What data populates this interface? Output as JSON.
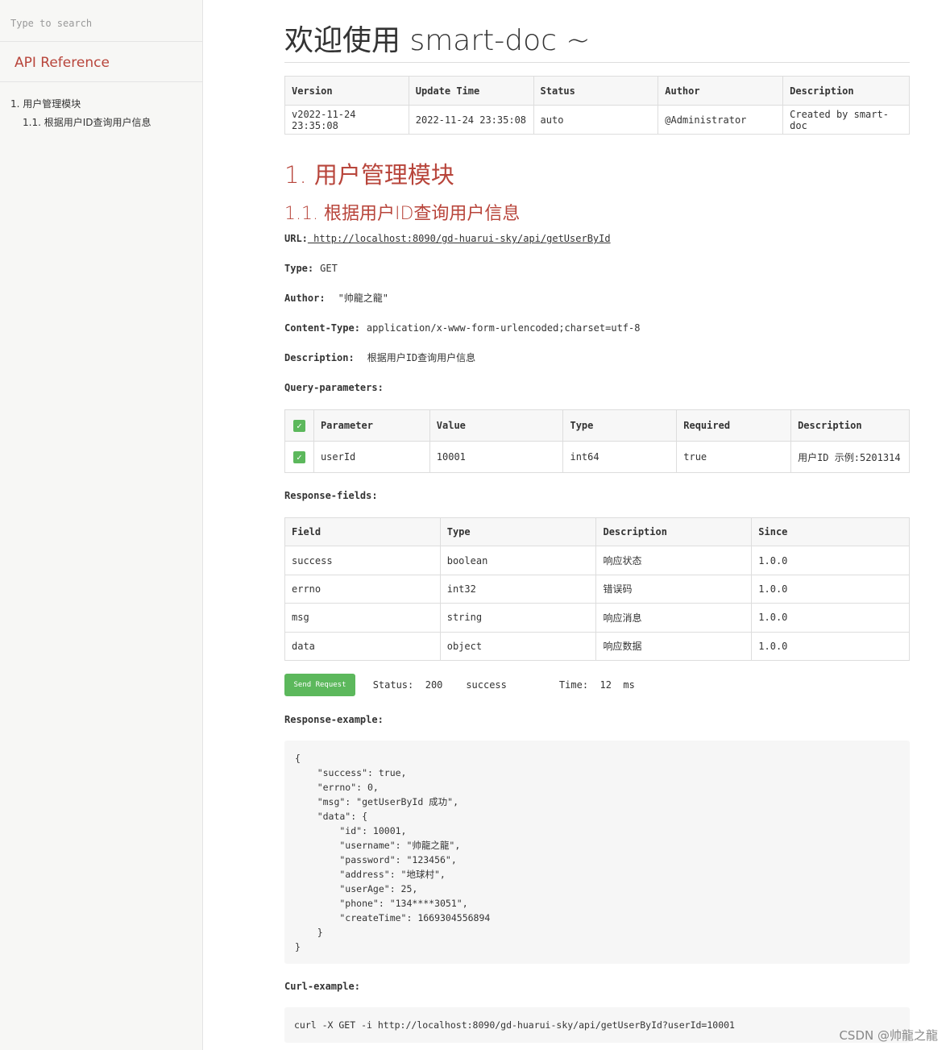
{
  "sidebar": {
    "search_placeholder": "Type to search",
    "title": "API Reference",
    "items": [
      {
        "label": "1. 用户管理模块"
      },
      {
        "label": "1.1. 根据用户ID查询用户信息"
      }
    ]
  },
  "page": {
    "title": "欢迎使用 smart-doc ~"
  },
  "info_table": {
    "headers": [
      "Version",
      "Update Time",
      "Status",
      "Author",
      "Description"
    ],
    "row": [
      "v2022-11-24 23:35:08",
      "2022-11-24 23:35:08",
      "auto",
      "@Administrator",
      "Created by smart-doc"
    ]
  },
  "module": {
    "title": "1. 用户管理模块"
  },
  "api": {
    "title": "1.1. 根据用户ID查询用户信息",
    "url_label": "URL:",
    "url": " http://localhost:8090/gd-huarui-sky/api/getUserById",
    "type_label": "Type:",
    "type": "GET",
    "author_label": "Author:",
    "author": "\"帅龍之龍\"",
    "content_type_label": "Content-Type:",
    "content_type": "application/x-www-form-urlencoded;charset=utf-8",
    "description_label": "Description:",
    "description": "根据用户ID查询用户信息",
    "query_params_label": "Query-parameters:",
    "response_fields_label": "Response-fields:",
    "response_example_label": "Response-example:",
    "curl_example_label": "Curl-example:"
  },
  "param_table": {
    "headers": [
      "Parameter",
      "Value",
      "Type",
      "Required",
      "Description"
    ],
    "rows": [
      [
        "userId",
        "10001",
        "int64",
        "true",
        "用户ID 示例:5201314"
      ]
    ]
  },
  "resp_table": {
    "headers": [
      "Field",
      "Type",
      "Description",
      "Since"
    ],
    "rows": [
      [
        "success",
        "boolean",
        "响应状态",
        "1.0.0"
      ],
      [
        "errno",
        "int32",
        "错误码",
        "1.0.0"
      ],
      [
        "msg",
        "string",
        "响应消息",
        "1.0.0"
      ],
      [
        "data",
        "object",
        "响应数据",
        "1.0.0"
      ]
    ]
  },
  "request": {
    "button_label": "Send Request",
    "status_label": "Status:",
    "status_code": "200",
    "status_text": "success",
    "time_label": "Time:",
    "time_value": "12",
    "time_unit": "ms"
  },
  "response_example": "{\n    \"success\": true,\n    \"errno\": 0,\n    \"msg\": \"getUserById 成功\",\n    \"data\": {\n        \"id\": 10001,\n        \"username\": \"帅龍之龍\",\n        \"password\": \"123456\",\n        \"address\": \"地球村\",\n        \"userAge\": 25,\n        \"phone\": \"134****3051\",\n        \"createTime\": 1669304556894\n    }\n}",
  "curl_example": "curl -X GET -i http://localhost:8090/gd-huarui-sky/api/getUserById?userId=10001",
  "watermark": "CSDN @帅龍之龍",
  "colors": {
    "accent": "#b8453b",
    "button": "#5cb85c",
    "sidebar_bg": "#f7f7f5"
  }
}
